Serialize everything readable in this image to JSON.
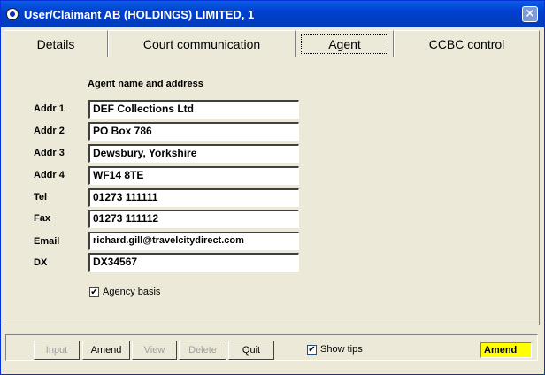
{
  "window": {
    "title": "User/Claimant AB (HOLDINGS) LIMITED, 1",
    "close_symbol": "✕"
  },
  "tabs": [
    {
      "label": "Details",
      "active": false
    },
    {
      "label": "Court communication",
      "active": false
    },
    {
      "label": "Agent",
      "active": true
    },
    {
      "label": "CCBC control",
      "active": false
    }
  ],
  "agent": {
    "section_title": "Agent name and address",
    "fields": [
      {
        "label": "Addr 1",
        "value": "DEF Collections Ltd"
      },
      {
        "label": "Addr 2",
        "value": "PO Box 786"
      },
      {
        "label": "Addr 3",
        "value": "Dewsbury, Yorkshire"
      },
      {
        "label": "Addr 4",
        "value": "WF14 8TE"
      },
      {
        "label": "Tel",
        "value": "01273 111111"
      },
      {
        "label": "Fax",
        "value": "01273 111112"
      },
      {
        "label": "Email",
        "value": "richard.gill@travelcitydirect.com"
      },
      {
        "label": "DX",
        "value": "DX34567"
      }
    ],
    "agency_basis": {
      "label": "Agency basis",
      "checked": true
    }
  },
  "toolbar": {
    "buttons": [
      {
        "label": "Input",
        "enabled": false
      },
      {
        "label": "Amend",
        "enabled": true
      },
      {
        "label": "View",
        "enabled": false
      },
      {
        "label": "Delete",
        "enabled": false
      },
      {
        "label": "Quit",
        "enabled": true
      }
    ],
    "show_tips": {
      "label": "Show tips",
      "checked": true
    },
    "mode": "Amend"
  },
  "colors": {
    "titlebar": "#0040cf",
    "mode_badge": "#ffff00",
    "face": "#ece9d8"
  }
}
